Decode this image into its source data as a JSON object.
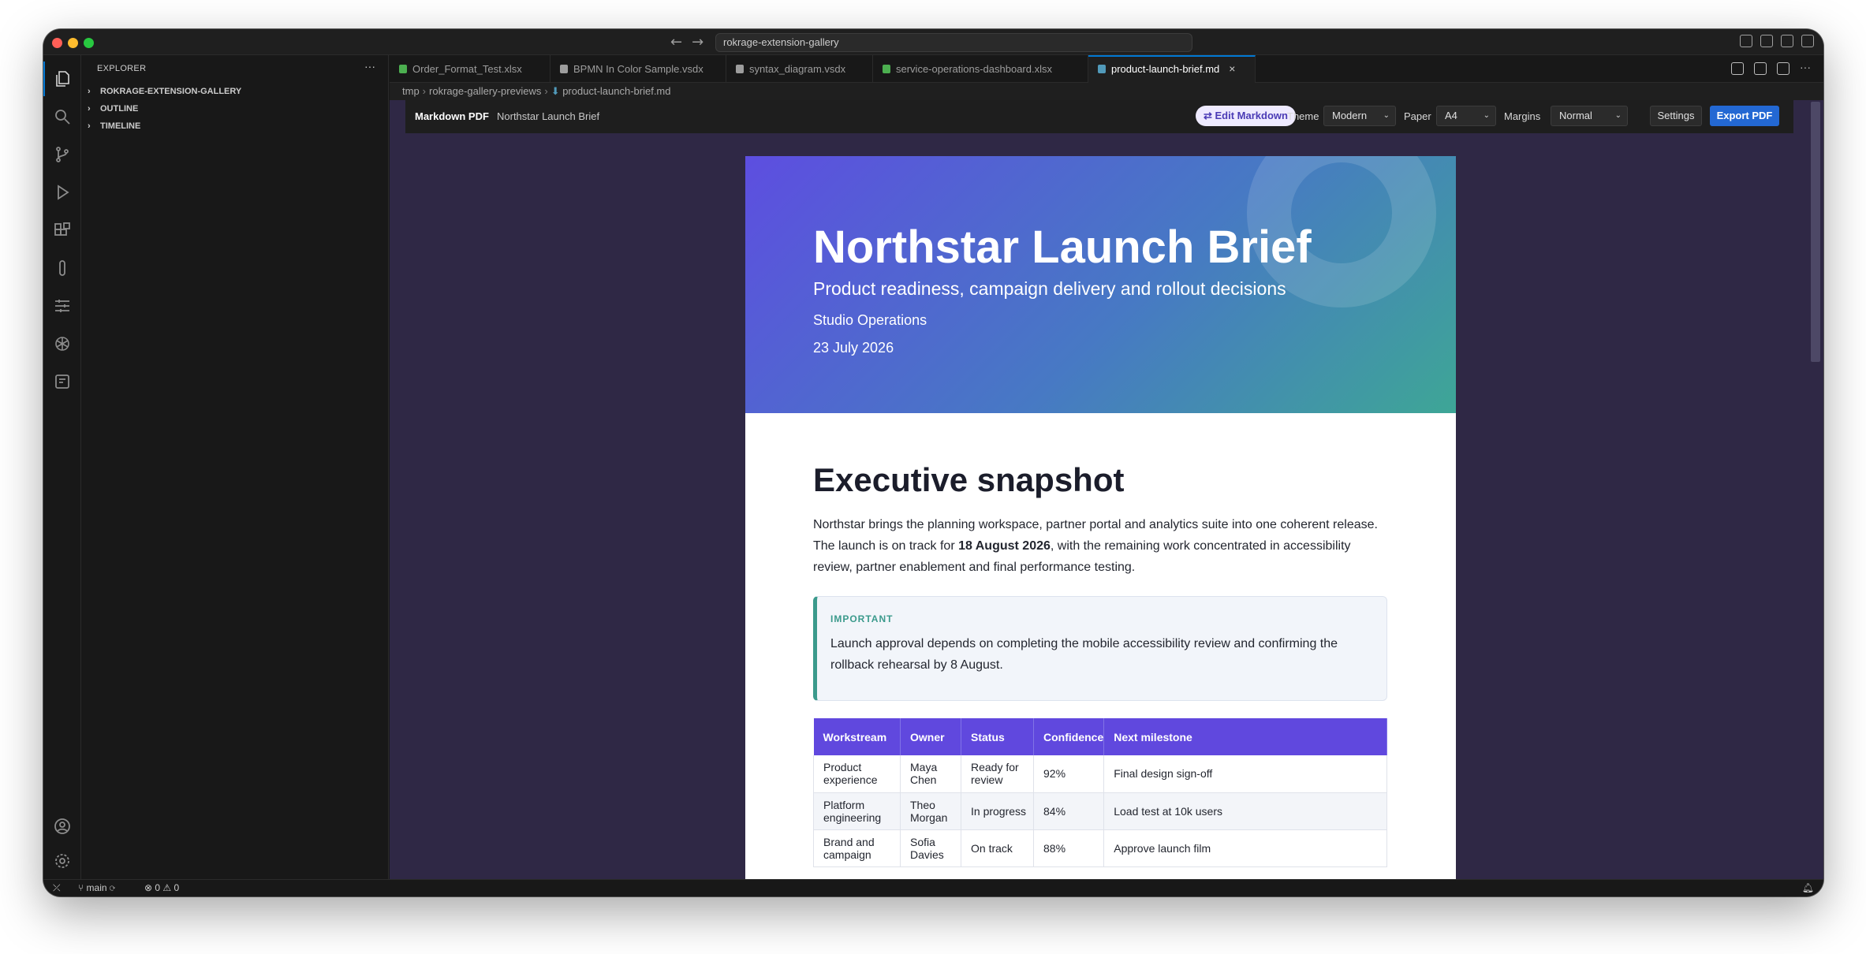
{
  "titlebar": {
    "search_text": "rokrage-extension-gallery"
  },
  "sidebar": {
    "header": "EXPLORER",
    "more": "···",
    "sections": [
      {
        "label": "ROKRAGE-EXTENSION-GALLERY"
      },
      {
        "label": "OUTLINE"
      },
      {
        "label": "TIMELINE"
      }
    ]
  },
  "tabs": [
    {
      "label": "Order_Format_Test.xlsx",
      "icon": "spreadsheet-icon",
      "color": "#4caf50"
    },
    {
      "label": "BPMN In Color Sample.vsdx",
      "icon": "list-icon",
      "color": "#9d9d9d"
    },
    {
      "label": "syntax_diagram.vsdx",
      "icon": "list-icon",
      "color": "#9d9d9d"
    },
    {
      "label": "service-operations-dashboard.xlsx",
      "icon": "spreadsheet-icon",
      "color": "#4caf50"
    },
    {
      "label": "product-launch-brief.md",
      "icon": "markdown-icon",
      "color": "#519aba",
      "active": true
    }
  ],
  "breadcrumb": {
    "parts": [
      "tmp",
      "rokrage-gallery-previews",
      "product-launch-brief.md"
    ]
  },
  "toolbar": {
    "title": "Markdown PDF",
    "doc_name": "Northstar Launch Brief",
    "edit_label": "⇄ Edit Markdown",
    "theme_label": "Theme",
    "theme_value": "Modern",
    "paper_label": "Paper",
    "paper_value": "A4",
    "margins_label": "Margins",
    "margins_value": "Normal",
    "settings_label": "Settings",
    "export_label": "Export PDF"
  },
  "document": {
    "hero": {
      "title": "Northstar Launch Brief",
      "subtitle": "Product readiness, campaign delivery and rollout decisions",
      "team": "Studio Operations",
      "date": "23 July 2026"
    },
    "section_title": "Executive snapshot",
    "paragraph_before": "Northstar brings the planning workspace, partner portal and analytics suite into one coherent release. The launch is on track for ",
    "paragraph_bold": "18 August 2026",
    "paragraph_after": ", with the remaining work concentrated in accessibility review, partner enablement and final performance testing.",
    "callout": {
      "label": "IMPORTANT",
      "text": "Launch approval depends on completing the mobile accessibility review and confirming the rollback rehearsal by 8 August."
    },
    "table": {
      "headers": [
        "Workstream",
        "Owner",
        "Status",
        "Confidence",
        "Next milestone"
      ],
      "rows": [
        [
          "Product experience",
          "Maya Chen",
          "Ready for review",
          "92%",
          "Final design sign-off"
        ],
        [
          "Platform engineering",
          "Theo Morgan",
          "In progress",
          "84%",
          "Load test at 10k users"
        ],
        [
          "Brand and campaign",
          "Sofia Davies",
          "On track",
          "88%",
          "Approve launch film"
        ]
      ]
    }
  },
  "statusbar": {
    "branch": "main",
    "errors": "0",
    "warnings": "0"
  }
}
